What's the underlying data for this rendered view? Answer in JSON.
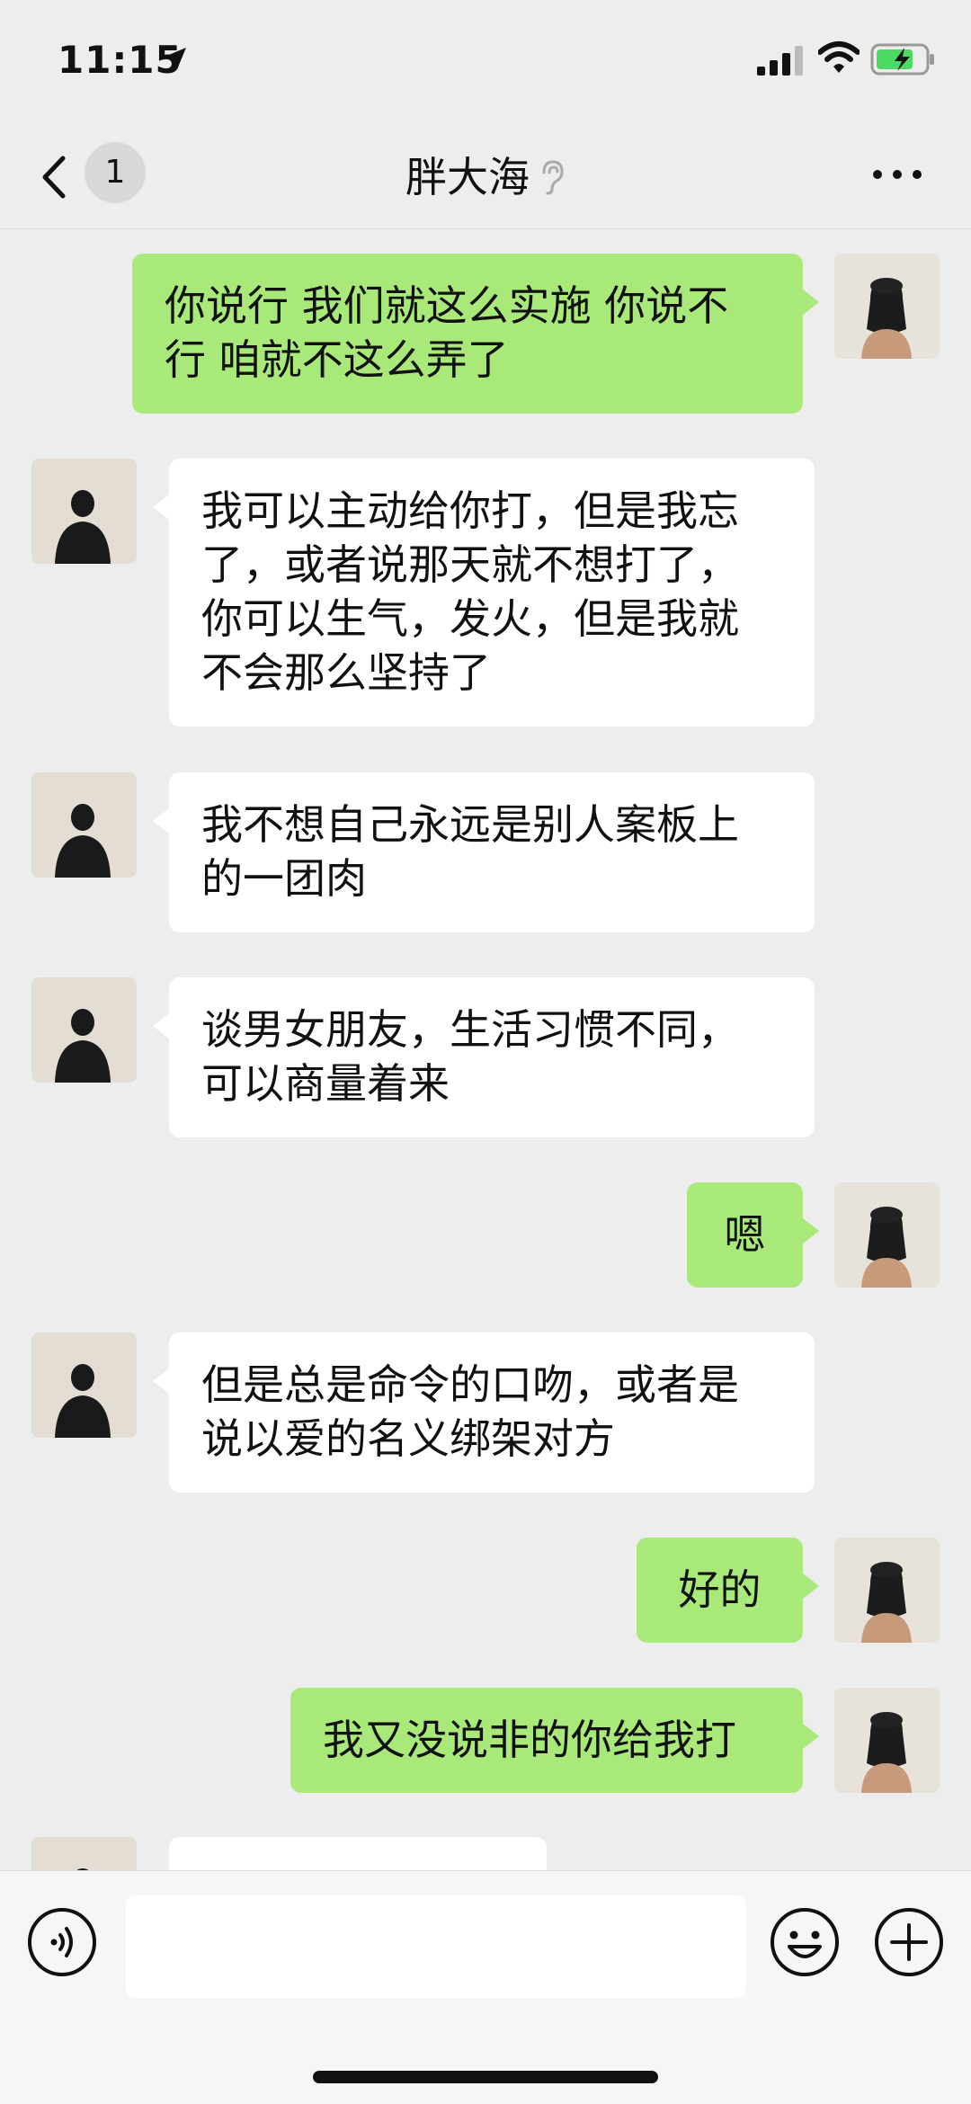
{
  "status_bar": {
    "time": "11:15"
  },
  "nav": {
    "unread_count": "1",
    "title": "胖大海"
  },
  "messages": [
    {
      "side": "out",
      "text": "你说行 我们就这么实施 你说不\n行 咱就不这么弄了"
    },
    {
      "side": "in",
      "text": "我可以主动给你打，但是我忘\n了，或者说那天就不想打了，\n你可以生气，发火，但是我就\n不会那么坚持了"
    },
    {
      "side": "in",
      "text": "我不想自己永远是别人案板上\n的一团肉"
    },
    {
      "side": "in",
      "text": "谈男女朋友，生活习惯不同，\n可以商量着来"
    },
    {
      "side": "out",
      "text": "嗯"
    },
    {
      "side": "in",
      "text": "但是总是命令的口吻，或者是\n说以爱的名义绑架对方"
    },
    {
      "side": "out",
      "text": "好的"
    },
    {
      "side": "out",
      "text": "我又没说非的你给我打"
    },
    {
      "side": "in",
      "text": ""
    }
  ],
  "colors": {
    "outgoing_bubble": "#a9e97a",
    "incoming_bubble": "#ffffff",
    "background": "#ededed",
    "battery_charging": "#4cd964"
  },
  "icons": {
    "back": "chevron-left-icon",
    "ear": "ear-icon",
    "more": "more-dots-icon",
    "voice": "voice-icon",
    "emoji": "emoji-icon",
    "plus": "plus-icon"
  }
}
